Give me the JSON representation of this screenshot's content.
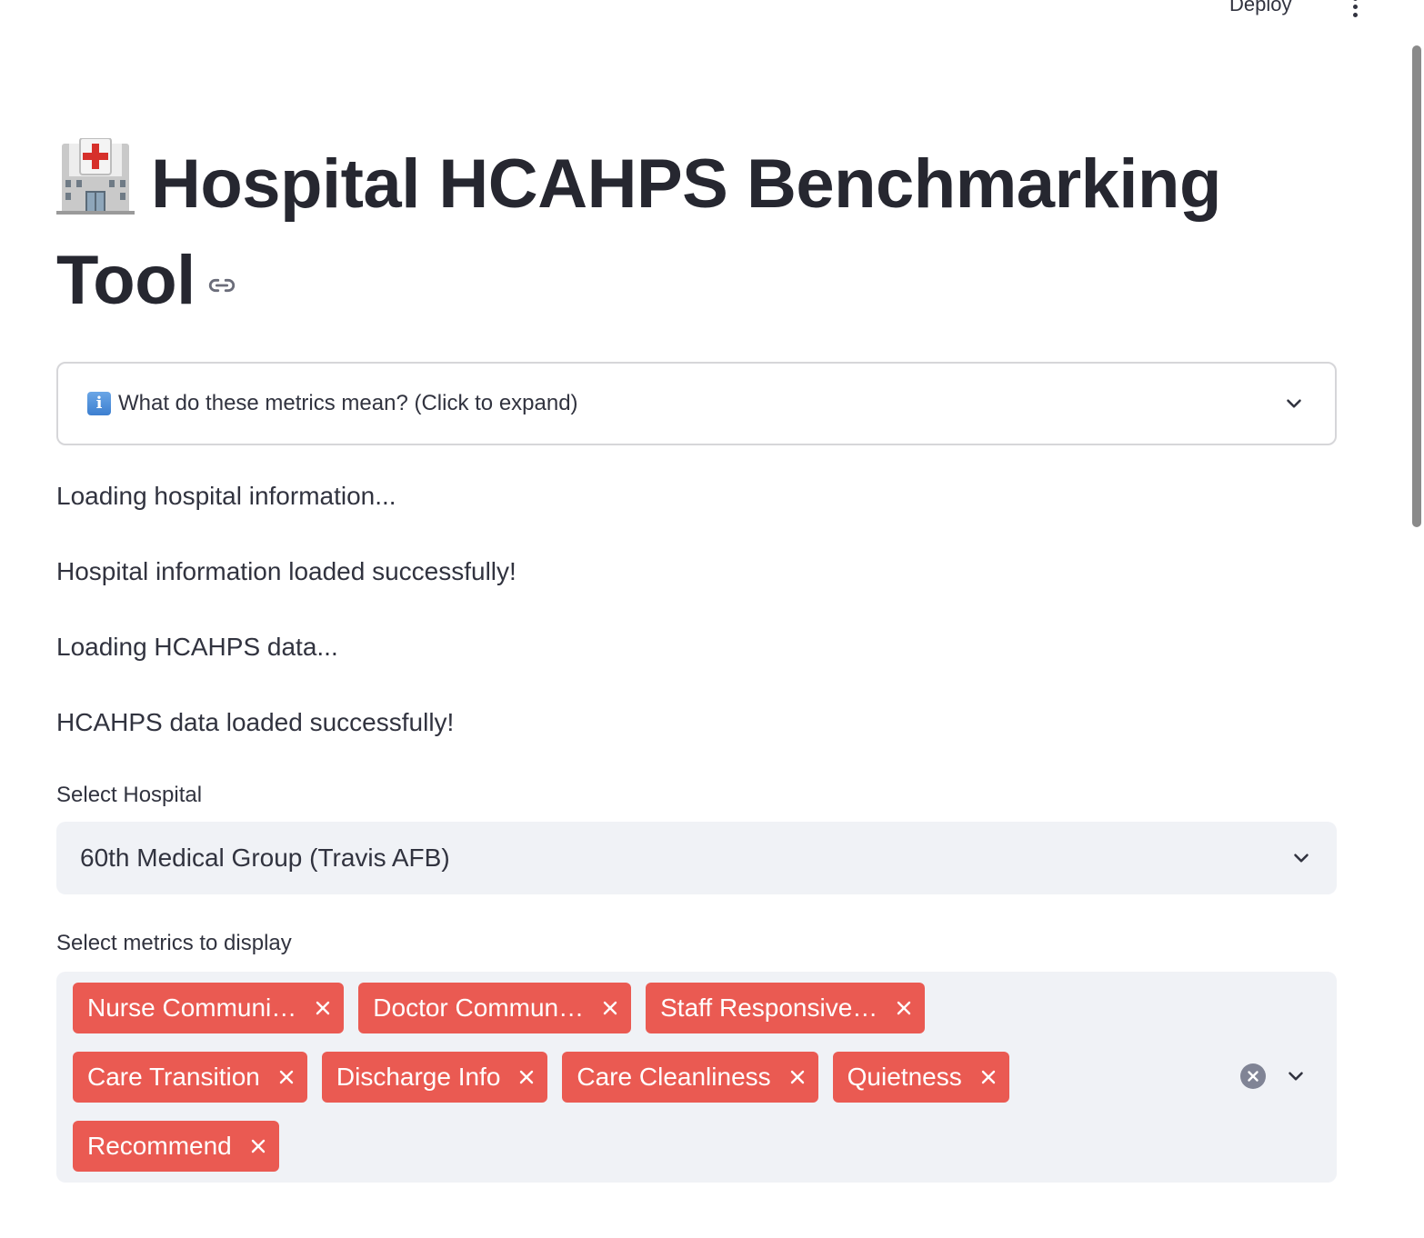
{
  "header": {
    "deploy_label": "Deploy"
  },
  "page": {
    "title_line1": "Hospital HCAHPS Benchmarking",
    "title_line2": "Tool"
  },
  "expander": {
    "label": "What do these metrics mean? (Click to expand)"
  },
  "status_messages": [
    "Loading hospital information...",
    "Hospital information loaded successfully!",
    "Loading HCAHPS data...",
    "HCAHPS data loaded successfully!"
  ],
  "hospital_select": {
    "label": "Select Hospital",
    "value": "60th Medical Group (Travis AFB)"
  },
  "metrics_select": {
    "label": "Select metrics to display",
    "tags": [
      "Nurse Communi…",
      "Doctor Commun…",
      "Staff Responsive…",
      "Care Transition",
      "Discharge Info",
      "Care Cleanliness",
      "Quietness",
      "Recommend"
    ],
    "tag_color": "#ea5a52"
  },
  "icons": {
    "title": "hospital-icon",
    "anchor": "link-icon",
    "expander_info": "info-icon",
    "chevron": "chevron-down-icon",
    "clear": "clear-all-icon",
    "tag_remove": "close-icon",
    "menu": "kebab-menu-icon"
  }
}
